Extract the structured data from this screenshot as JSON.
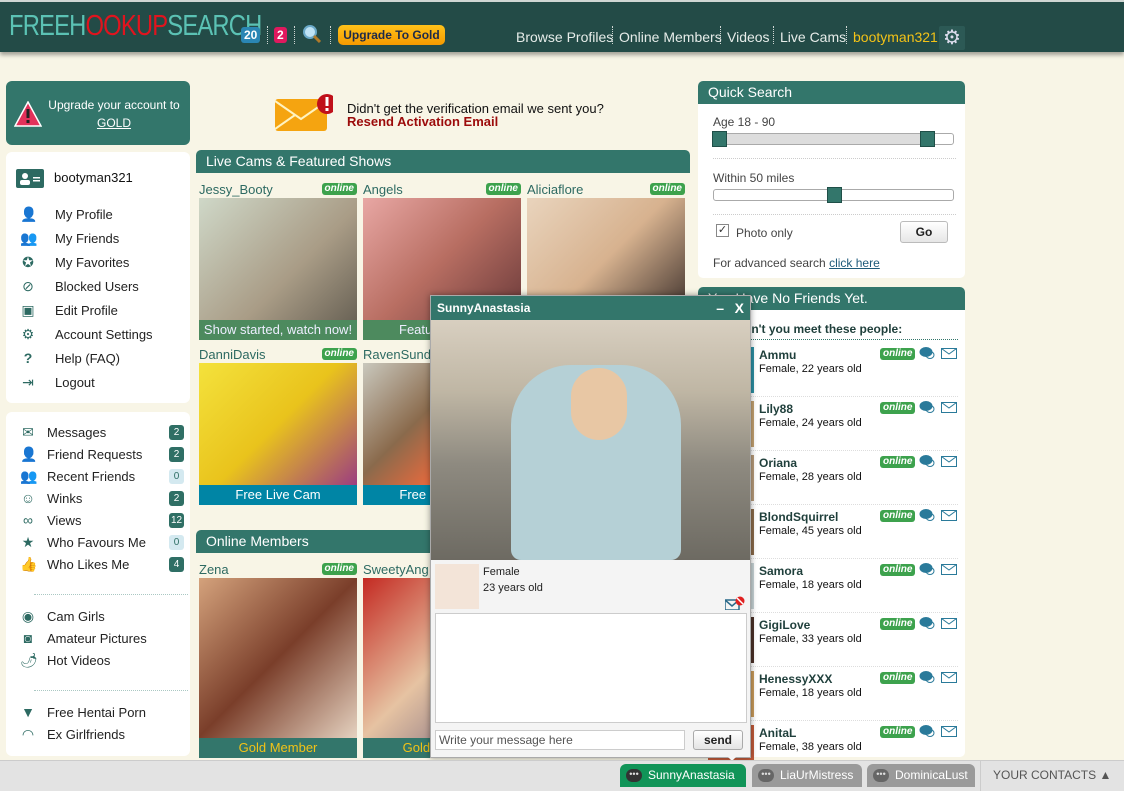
{
  "header": {
    "logo": {
      "part1": "FREEH",
      "part2": "❀",
      "part3": "KUP",
      "part4": "SEARCH"
    },
    "messages_badge": "20",
    "alerts_badge": "2",
    "upgrade_label": "Upgrade To Gold",
    "nav": [
      "Browse Profiles",
      "Online Members",
      "Videos",
      "Live Cams"
    ],
    "username": "bootyman321",
    "settings_icon": "gear-icon"
  },
  "upgrade_box": {
    "line1": "Upgrade your account to",
    "link": "GOLD"
  },
  "user_menu": {
    "username": "bootyman321",
    "items": [
      {
        "label": "My Profile",
        "icon": "user-icon"
      },
      {
        "label": "My Friends",
        "icon": "friends-icon"
      },
      {
        "label": "My Favorites",
        "icon": "star-circle-icon"
      },
      {
        "label": "Blocked Users",
        "icon": "eye-slash-icon"
      },
      {
        "label": "Edit Profile",
        "icon": "monitor-edit-icon"
      },
      {
        "label": "Account Settings",
        "icon": "cogs-icon"
      },
      {
        "label": "Help (FAQ)",
        "icon": "question-icon"
      },
      {
        "label": "Logout",
        "icon": "logout-icon"
      }
    ]
  },
  "activity_menu": {
    "items": [
      {
        "label": "Messages",
        "count": "2"
      },
      {
        "label": "Friend Requests",
        "count": "2"
      },
      {
        "label": "Recent Friends",
        "count": "0"
      },
      {
        "label": "Winks",
        "count": "2"
      },
      {
        "label": "Views",
        "count": "12"
      },
      {
        "label": "Who Favours Me",
        "count": "0"
      },
      {
        "label": "Who Likes Me",
        "count": "4"
      }
    ],
    "links": [
      "Cam Girls",
      "Amateur Pictures",
      "Hot Videos"
    ],
    "links2": [
      "Free Hentai Porn",
      "Ex Girlfriends"
    ]
  },
  "verification": {
    "text": "Didn't get the verification email we sent you?",
    "link": "Resend Activation Email"
  },
  "live_cams": {
    "title": "Live Cams & Featured Shows",
    "cards": [
      {
        "name": "Jessy_Booty",
        "status": "online",
        "caption": "Show started, watch now!"
      },
      {
        "name": "Angels",
        "status": "online",
        "caption": "Featured show"
      },
      {
        "name": "Aliciaflore",
        "status": "online",
        "caption": ""
      },
      {
        "name": "DanniDavis",
        "status": "online",
        "caption": "Free Live Cam"
      },
      {
        "name": "RavenSund",
        "status": "",
        "caption": "Free Live Cam"
      }
    ]
  },
  "online_members": {
    "title": "Online Members",
    "cards": [
      {
        "name": "Zena",
        "status": "online",
        "caption": "Gold Member"
      },
      {
        "name": "SweetyAng",
        "status": "",
        "caption": "Gold Member"
      }
    ]
  },
  "quick_search": {
    "title": "Quick Search",
    "age_label": "Age 18 - 90",
    "age_min": 18,
    "age_max": 90,
    "distance_label": "Within 50 miles",
    "distance": 50,
    "photo_only_label": "Photo only",
    "photo_only": true,
    "go_label": "Go",
    "advanced_text": "For advanced search",
    "advanced_link": "click here"
  },
  "friends": {
    "title": "You Have No Friends Yet.",
    "subtitle": "Why don't you meet these people:",
    "people": [
      {
        "name": "Ammu",
        "info": "Female, 22 years old",
        "status": "online"
      },
      {
        "name": "Lily88",
        "info": "Female, 24 years old",
        "status": "online"
      },
      {
        "name": "Oriana",
        "info": "Female, 28 years old",
        "status": "online"
      },
      {
        "name": "BlondSquirrel",
        "info": "Female, 45 years old",
        "status": "online"
      },
      {
        "name": "Samora",
        "info": "Female, 18 years old",
        "status": "online"
      },
      {
        "name": "GigiLove",
        "info": "Female, 33 years old",
        "status": "online"
      },
      {
        "name": "HenessyXXX",
        "info": "Female, 18 years old",
        "status": "online"
      },
      {
        "name": "AnitaL",
        "info": "Female, 38 years old",
        "status": "online"
      }
    ]
  },
  "chat_window": {
    "title": "SunnyAnastasia",
    "minimize": "–",
    "close": "X",
    "gender": "Female",
    "age": "23 years old",
    "message_placeholder": "Write your message here",
    "send_label": "send"
  },
  "chat_bar": {
    "tabs": [
      "SunnyAnastasia",
      "LiaUrMistress",
      "DominicaLust"
    ],
    "contacts_label": "YOUR CONTACTS ▲"
  }
}
